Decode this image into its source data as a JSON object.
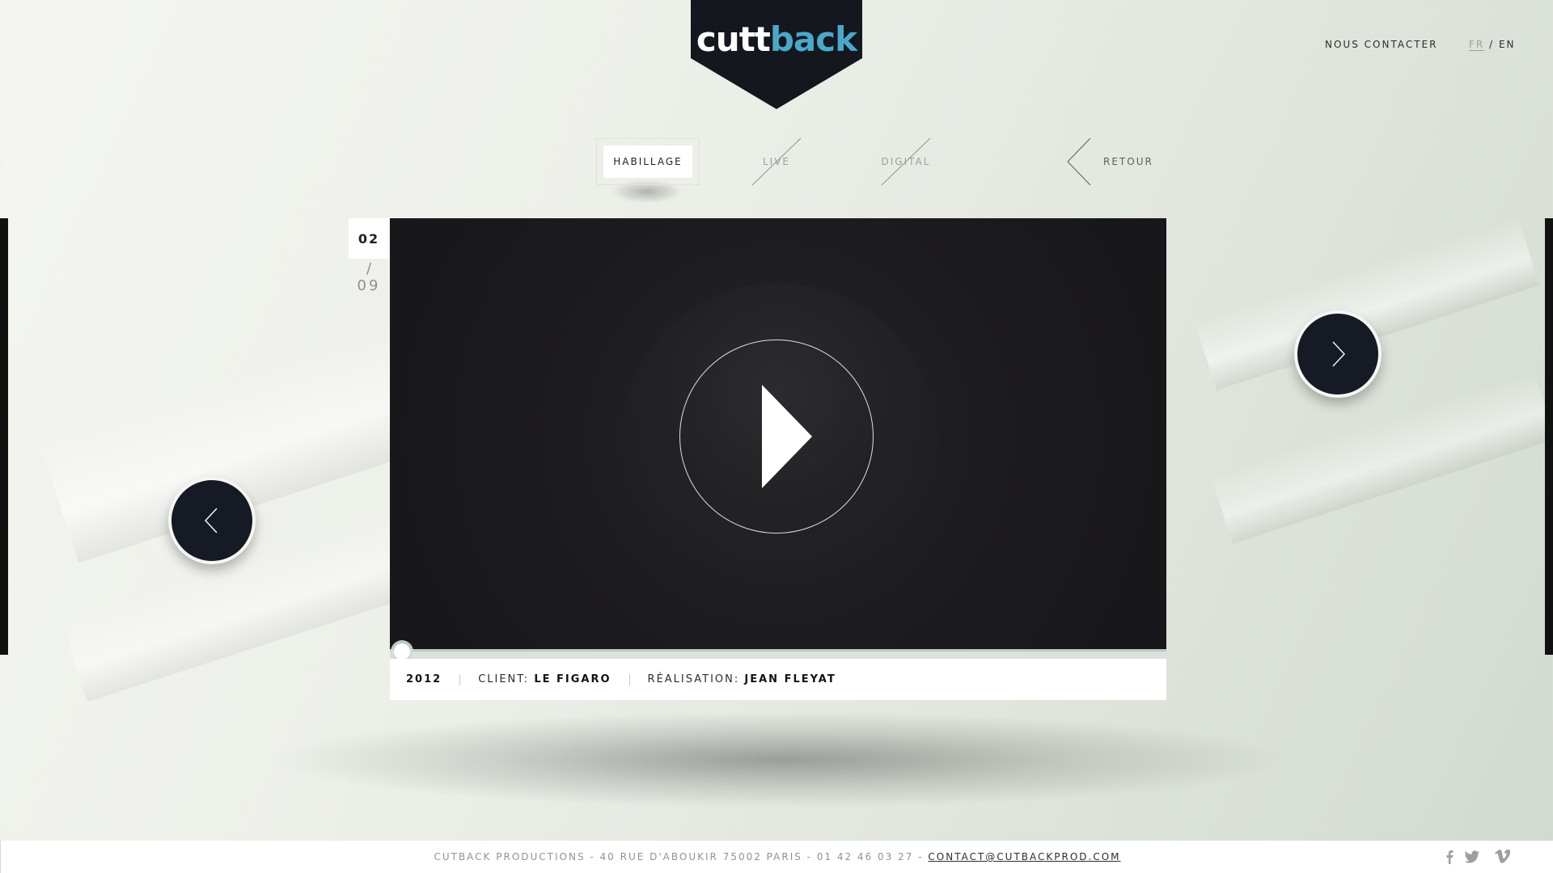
{
  "header": {
    "logo": {
      "part1": "cutt",
      "part2": "back",
      "brand": "#15171f",
      "accent": "#4aa9c9"
    },
    "contact_label": "NOUS CONTACTER",
    "lang": {
      "fr": "FR",
      "separator": "/",
      "en": "EN",
      "active": "FR"
    }
  },
  "categories": {
    "active": "HABILLAGE",
    "live": "LIVE",
    "digital": "DIGITAL",
    "back": "RETOUR"
  },
  "counter": {
    "current": "02",
    "separator": "/",
    "total": "09"
  },
  "video": {
    "playing": false,
    "progress": 0.0
  },
  "info": {
    "year": "2012",
    "client_label": "CLIENT:",
    "client_value": "LE FIGARO",
    "director_label": "RÉALISATION:",
    "director_value": "JEAN FLEYAT"
  },
  "nav": {
    "prev_icon": "chevron-left-icon",
    "next_icon": "chevron-right-icon"
  },
  "footer": {
    "address": "CUTBACK PRODUCTIONS - 40 RUE D'ABOUKIR 75002 PARIS - 01 42 46 03 27 -",
    "email": "CONTACT@CUTBACKPROD.COM",
    "social": [
      "facebook-icon",
      "twitter-icon",
      "vimeo-icon"
    ]
  },
  "colors": {
    "dark": "#151a24",
    "background": "#eceee8",
    "accent": "#4aa9c9"
  }
}
